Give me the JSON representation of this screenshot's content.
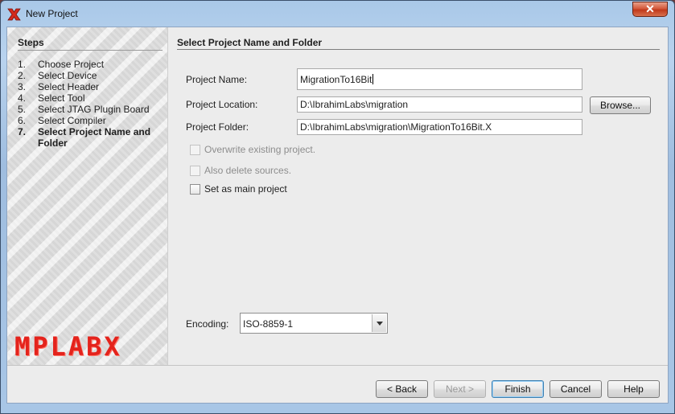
{
  "window": {
    "title": "New Project",
    "close_glyph": "✕",
    "icon": "mplab-x-icon"
  },
  "steps": {
    "title": "Steps",
    "items": [
      {
        "num": "1.",
        "label": "Choose Project"
      },
      {
        "num": "2.",
        "label": "Select Device"
      },
      {
        "num": "3.",
        "label": "Select Header"
      },
      {
        "num": "4.",
        "label": "Select Tool"
      },
      {
        "num": "5.",
        "label": "Select JTAG Plugin Board"
      },
      {
        "num": "6.",
        "label": "Select Compiler"
      },
      {
        "num": "7.",
        "label": "Select Project Name and Folder"
      }
    ],
    "current_index": 6,
    "logo_text": "MPLABX"
  },
  "page": {
    "title": "Select Project Name and Folder",
    "project_name": {
      "label": "Project Name:",
      "value": "MigrationTo16Bit"
    },
    "project_location": {
      "label": "Project Location:",
      "value": "D:\\IbrahimLabs\\migration",
      "browse_label": "Browse..."
    },
    "project_folder": {
      "label": "Project Folder:",
      "value": "D:\\IbrahimLabs\\migration\\MigrationTo16Bit.X"
    },
    "overwrite": {
      "label": "Overwrite existing project.",
      "checked": false,
      "enabled": false
    },
    "delete_sources": {
      "label": "Also delete sources.",
      "checked": false,
      "enabled": false
    },
    "main_project": {
      "label": "Set as main project",
      "checked": false,
      "enabled": true
    },
    "encoding": {
      "label": "Encoding:",
      "value": "ISO-8859-1"
    }
  },
  "buttons": {
    "back": "< Back",
    "next": "Next >",
    "finish": "Finish",
    "cancel": "Cancel",
    "help": "Help"
  }
}
